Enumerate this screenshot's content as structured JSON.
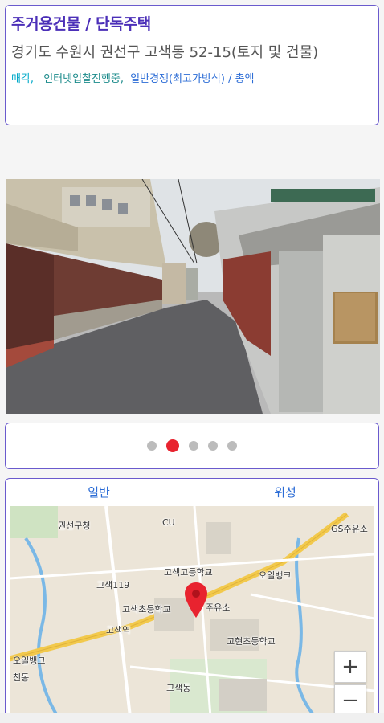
{
  "listing": {
    "category": "주거용건물 / 단독주택",
    "address": "경기도 수원시 권선구 고색동 52-15(토지 및 건물)",
    "tag_sale": "매각,",
    "tag_status": "인터넷입찰진행중,",
    "tag_type": "일반경쟁(최고가방식) / 총액"
  },
  "carousel": {
    "count": 5,
    "active_index": 1
  },
  "map": {
    "tabs": [
      "일반",
      "위성"
    ],
    "labels": {
      "gwonseon_office": "권선구청",
      "cu": "CU",
      "gs_station": "GS주유소",
      "gosaek_high": "고색고등학교",
      "oil_bank_1": "오일뱅크",
      "gosaek_119": "고색119",
      "gosaek_elem": "고색초등학교",
      "gas_station": "주유소",
      "gosaek_station": "고색역",
      "gohyeon_elem": "고현초등학교",
      "oil_bank_2": "오일뱅크",
      "gosaek_dong": "고색동",
      "area_text": "천동"
    },
    "zoom_in": "+",
    "zoom_out": "−"
  },
  "colors": {
    "accent": "#6a5acd",
    "category": "#4b2fb8",
    "pin": "#e8232f"
  }
}
